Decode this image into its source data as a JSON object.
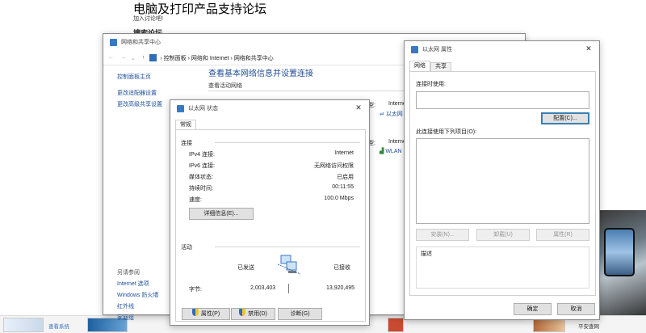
{
  "forum": {
    "title": "电脑及打印产品支持论坛",
    "subtitle": "加入讨论吧!",
    "search_label": "搜索论坛"
  },
  "taskbar": {
    "item1_label": "查看系统",
    "item2_label": "平安查网"
  },
  "network_center": {
    "window_title": "网络和共享中心",
    "breadcrumb": [
      "控制面板",
      "网络和 Internet",
      "网络和共享中心"
    ],
    "sidebar_links": [
      "控制面板主页",
      "更改适配器设置",
      "更改高级共享设置"
    ],
    "see_also_title": "另请参阅",
    "see_also_links": [
      "Internet 选项",
      "Windows 防火墙",
      "红外线",
      "家庭组"
    ],
    "heading": "查看基本网络信息并设置连接",
    "active_networks": "查看活动网络",
    "access_type_label_1": "型:",
    "access_value_1": "Internet",
    "conn_link_1": "以太网",
    "access_type_label_2": "型:",
    "access_value_2": "Internet",
    "conn_link_2": "WLAN"
  },
  "status_dialog": {
    "title": "以太网 状态",
    "tab": "常规",
    "section_connection": "连接",
    "rows": [
      {
        "k": "IPv4 连接:",
        "v": "Internet"
      },
      {
        "k": "IPv6 连接:",
        "v": "无网络访问权限"
      },
      {
        "k": "媒体状态:",
        "v": "已启用"
      },
      {
        "k": "持续时间:",
        "v": "00:11:55"
      },
      {
        "k": "速度:",
        "v": "100.0 Mbps"
      }
    ],
    "details_button": "详细信息(E)...",
    "section_activity": "活动",
    "sent_label": "已发送",
    "received_label": "已接收",
    "bytes_label": "字节:",
    "bytes_sent": "2,003,403",
    "bytes_received": "13,920,495",
    "properties_button": "属性(P)",
    "disable_button": "禁用(D)",
    "diagnose_button": "诊断(G)"
  },
  "properties_dialog": {
    "title": "以太网 属性",
    "tabs": [
      "网络",
      "共享"
    ],
    "connect_using_label": "连接时使用:",
    "configure_button": "配置(C)...",
    "items_label": "此连接使用下列项目(O):",
    "install_button": "安装(N)...",
    "uninstall_button": "卸载(U)",
    "item_properties_button": "属性(R)",
    "description_label": "描述",
    "ok_button": "确定",
    "cancel_button": "取消"
  }
}
